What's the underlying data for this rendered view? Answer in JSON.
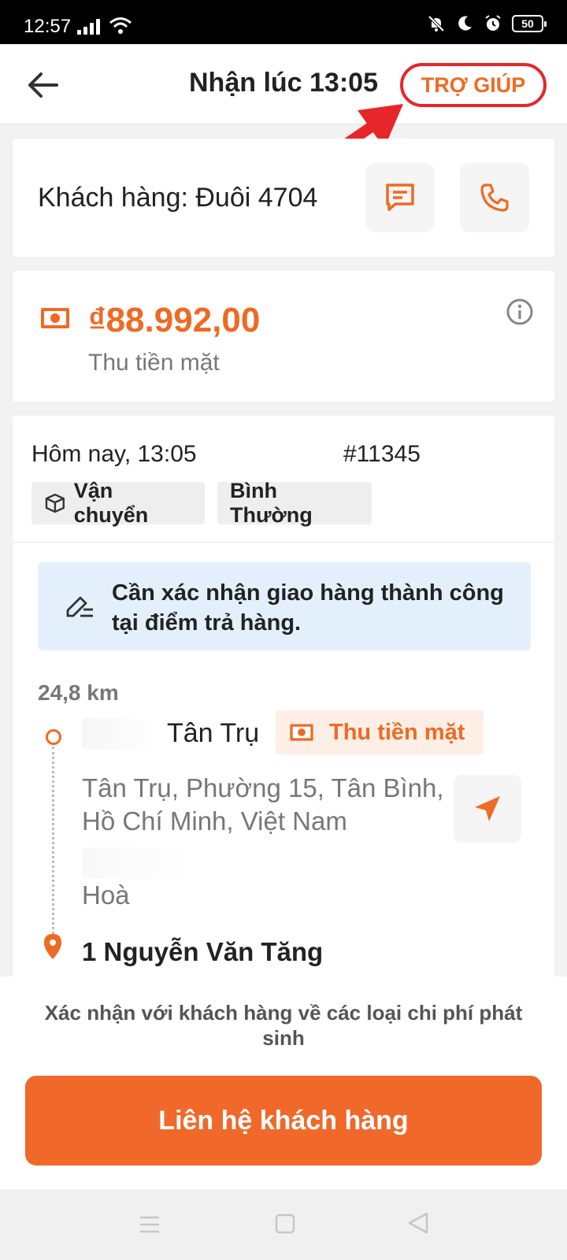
{
  "status_bar": {
    "time": "12:57",
    "battery": "50"
  },
  "header": {
    "title": "Nhận lúc 13:05",
    "help_label": "TRỢ GIÚP"
  },
  "customer": {
    "label": "Khách hàng: Đuôi 4704"
  },
  "payment": {
    "amount": "₫88.992,00",
    "method": "Thu tiền mặt"
  },
  "order": {
    "time": "Hôm nay, 13:05",
    "id": "#11345",
    "tags": [
      "Vận chuyển",
      "Bình Thường"
    ]
  },
  "notice": {
    "text": "Cần xác nhận giao hàng thành công tại điểm trả hàng."
  },
  "route": {
    "distance": "24,8 km",
    "pickup": {
      "name": "Tân Trụ",
      "payment_badge": "Thu tiền mặt",
      "address": "Tân Trụ, Phường 15, Tân Bình, Hồ Chí Minh, Việt Nam",
      "extra": "Hoà"
    },
    "dropoff": {
      "name": "1 Nguyễn Văn Tăng"
    }
  },
  "bottom": {
    "note": "Xác nhận với khách hàng về các loại chi phí phát sinh",
    "cta_label": "Liên hệ khách hàng"
  },
  "colors": {
    "accent": "#ef6a23",
    "annotation": "#e6262b",
    "notice_bg": "#e3f0fb"
  }
}
